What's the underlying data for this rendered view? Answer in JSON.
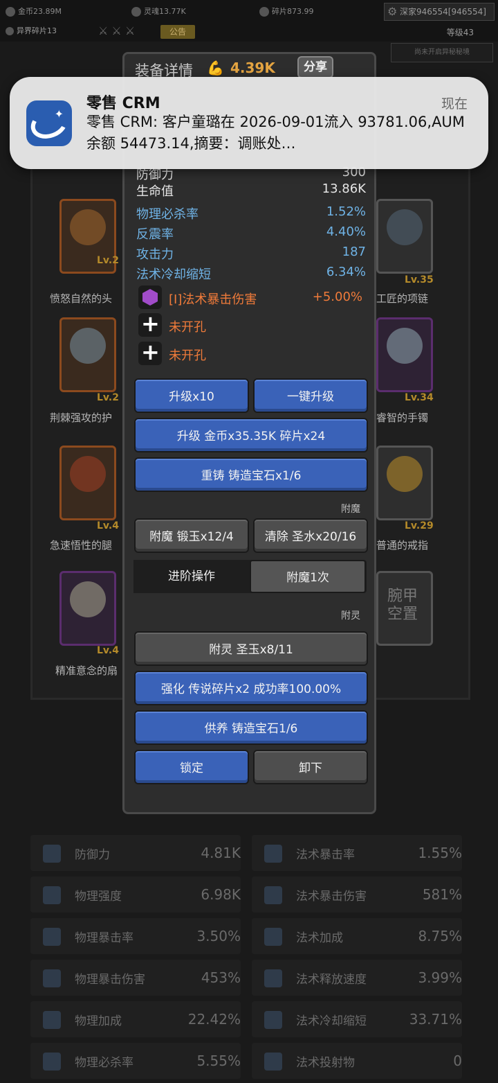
{
  "topbar": {
    "gold": "金币23.89M",
    "soul": "灵魂13.77K",
    "shards": "碎片873.99",
    "player": "深家946554[946554]",
    "otherworld": "异界碎片13",
    "announcement": "公告",
    "level": "等级43",
    "unopened": "尚未开启异秘秘境"
  },
  "notification": {
    "app": "零售 CRM",
    "time": "现在",
    "body": "零售 CRM: 客户童璐在 2026-09-01流入 93781.06,AUM余额 54473.14,摘要：调账处…"
  },
  "dialog": {
    "title": "装备详情",
    "power": "4.39K",
    "share": "分享",
    "stats": [
      {
        "name": "防御力",
        "value": "300",
        "color": "white"
      },
      {
        "name": "生命值",
        "value": "13.86K",
        "color": "white"
      },
      {
        "name": "物理必杀率",
        "value": "1.52%",
        "color": "blue"
      },
      {
        "name": "反震率",
        "value": "4.40%",
        "color": "blue"
      },
      {
        "name": "攻击力",
        "value": "187",
        "color": "blue"
      },
      {
        "name": "法术冷却缩短",
        "value": "6.34%",
        "color": "blue"
      }
    ],
    "gem_slots": [
      {
        "label": "[I]法术暴击伤害",
        "value": "+5.00%"
      },
      {
        "label": "未开孔",
        "value": ""
      },
      {
        "label": "未开孔",
        "value": ""
      }
    ],
    "buttons": {
      "upgrade10": "升级x10",
      "one_click": "一键升级",
      "upgrade_cost": "升级 金币x35.35K 碎片x24",
      "reforge": "重铸 铸造宝石x1/6",
      "enchant_section": "附魔",
      "enchant": "附魔 锻玉x12/4",
      "clear": "清除 圣水x20/16",
      "tab_advanced": "进阶操作",
      "tab_enchant_once": "附魔1次",
      "spirit_section": "附灵",
      "spirit": "附灵 圣玉x8/11",
      "strengthen": "强化 传说碎片x2 成功率100.00%",
      "nourish": "供养 铸造宝石1/6",
      "lock": "锁定",
      "unequip": "卸下"
    }
  },
  "equipment": [
    {
      "lv": "Lv.2",
      "name": "愤怒自然的头"
    },
    {
      "lv": "Lv.35",
      "name": "工匠的项链"
    },
    {
      "lv": "Lv.2",
      "name": "荆棘强攻的护"
    },
    {
      "lv": "Lv.34",
      "name": "睿智的手镯"
    },
    {
      "lv": "Lv.4",
      "name": "急速悟性的腿"
    },
    {
      "lv": "Lv.29",
      "name": "普通的戒指"
    },
    {
      "lv": "Lv.4",
      "name": "精准意念的扇"
    }
  ],
  "wrist_empty": "腕甲空置",
  "bottom_stats": [
    {
      "name": "防御力",
      "value": "4.81K"
    },
    {
      "name": "法术暴击率",
      "value": "1.55%"
    },
    {
      "name": "物理强度",
      "value": "6.98K"
    },
    {
      "name": "法术暴击伤害",
      "value": "581%"
    },
    {
      "name": "物理暴击率",
      "value": "3.50%"
    },
    {
      "name": "法术加成",
      "value": "8.75%"
    },
    {
      "name": "物理暴击伤害",
      "value": "453%"
    },
    {
      "name": "法术释放速度",
      "value": "3.99%"
    },
    {
      "name": "物理加成",
      "value": "22.42%"
    },
    {
      "name": "法术冷却缩短",
      "value": "33.71%"
    },
    {
      "name": "物理必杀率",
      "value": "5.55%"
    },
    {
      "name": "法术投射物",
      "value": "0"
    }
  ]
}
